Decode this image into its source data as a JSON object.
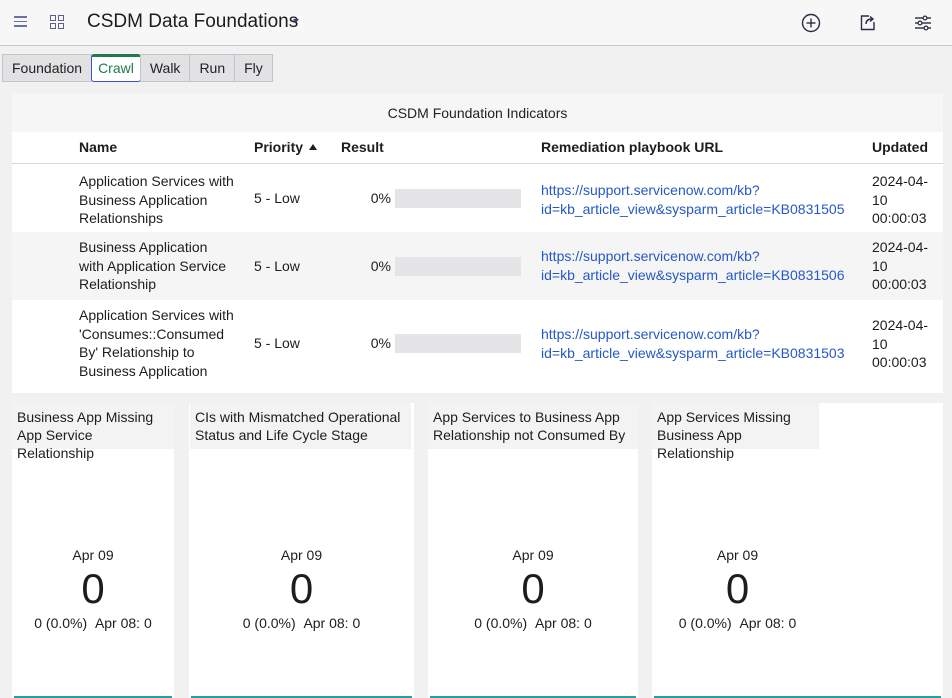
{
  "header": {
    "title": "CSDM Data Foundations",
    "icons": [
      "menu-icon",
      "apps-grid-icon",
      "chevron-down-icon",
      "add-circle-icon",
      "share-icon",
      "filter-settings-icon"
    ]
  },
  "tabs": [
    {
      "label": "Foundation"
    },
    {
      "label": "Crawl"
    },
    {
      "label": "Walk"
    },
    {
      "label": "Run"
    },
    {
      "label": "Fly"
    }
  ],
  "indicators": {
    "title": "CSDM Foundation Indicators",
    "columns": {
      "name": "Name",
      "priority": "Priority",
      "result": "Result",
      "url": "Remediation playbook URL",
      "updated": "Updated"
    },
    "rows": [
      {
        "name": [
          "Application Services with",
          "Business Application",
          "Relationships"
        ],
        "priority": "5 - Low",
        "result": "0%",
        "url": [
          "https://support.servicenow.com/kb?",
          "id=kb_article_view&sysparm_article=KB0831505"
        ],
        "updated": [
          "2024-04-",
          "10",
          "00:00:03"
        ]
      },
      {
        "name": [
          "Business Application",
          "with Application Service",
          "Relationship"
        ],
        "priority": "5 - Low",
        "result": "0%",
        "url": [
          "https://support.servicenow.com/kb?",
          "id=kb_article_view&sysparm_article=KB0831506"
        ],
        "updated": [
          "2024-04-",
          "10",
          "00:00:03"
        ]
      },
      {
        "name": [
          "Application Services with",
          "'Consumes::Consumed",
          "By' Relationship to",
          "Business Application"
        ],
        "priority": "5 - Low",
        "result": "0%",
        "url": [
          "https://support.servicenow.com/kb?",
          "id=kb_article_view&sysparm_article=KB0831503"
        ],
        "updated": [
          "2024-04-",
          "10",
          "00:00:03"
        ]
      }
    ]
  },
  "cards": [
    {
      "title": [
        "Business App Missing",
        "App Service Relationship"
      ],
      "date": "Apr 09",
      "value": "0",
      "change": "0 (0.0%)",
      "previous": "Apr 08: 0"
    },
    {
      "title": [
        "CIs with Mismatched Operational",
        "Status and Life Cycle Stage"
      ],
      "date": "Apr 09",
      "value": "0",
      "change": "0 (0.0%)",
      "previous": "Apr 08: 0"
    },
    {
      "title": [
        "App Services to Business App",
        "Relationship not Consumed By"
      ],
      "date": "Apr 09",
      "value": "0",
      "change": "0 (0.0%)",
      "previous": "Apr 08: 0"
    },
    {
      "title": [
        "App Services Missing",
        "Business App Relationship"
      ],
      "date": "Apr 09",
      "value": "0",
      "change": "0 (0.0%)",
      "previous": "Apr 08: 0"
    }
  ]
}
